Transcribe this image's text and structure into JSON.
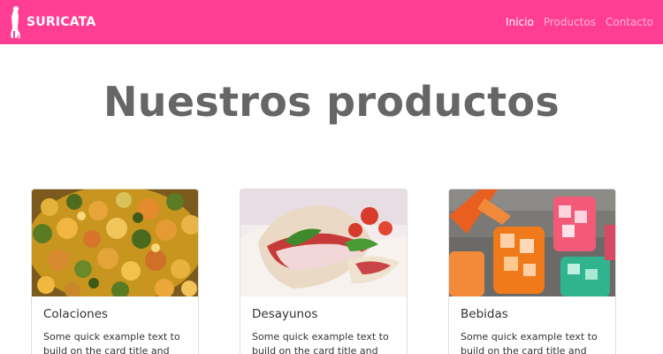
{
  "navbar": {
    "brand": "SURICATA",
    "links": [
      {
        "label": "Inicio",
        "active": true
      },
      {
        "label": "Productos",
        "active": false
      },
      {
        "label": "Contacto",
        "active": false
      }
    ],
    "color": "#ff3e93"
  },
  "main": {
    "title": "Nuestros productos",
    "cards": [
      {
        "title": "Colaciones",
        "text": "Some quick example text to build on the card title and make"
      },
      {
        "title": "Desayunos",
        "text": "Some quick example text to build on the card title and make"
      },
      {
        "title": "Bebidas",
        "text": "Some quick example text to build on the card title and make"
      }
    ]
  }
}
